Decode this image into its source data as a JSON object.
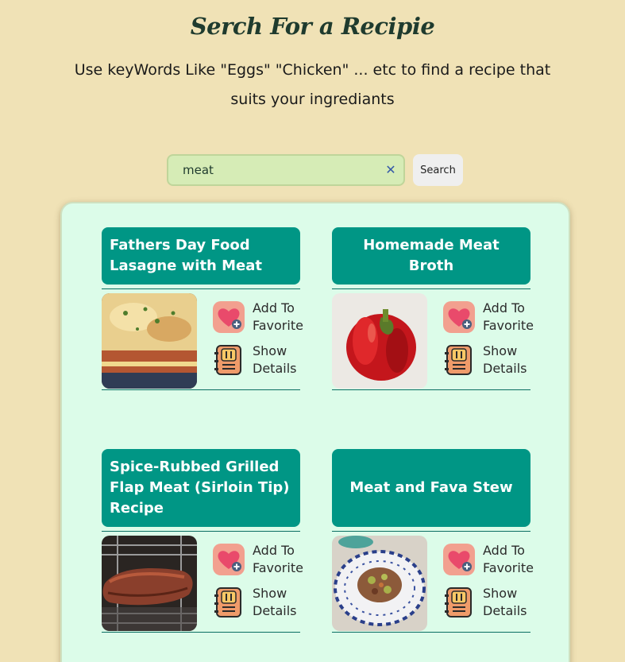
{
  "header": {
    "title": "Serch For a Recipie",
    "subtitle": "Use keyWords Like \"Eggs\" \"Chicken\" ... etc to find a recipe that suits your ingrediants"
  },
  "search": {
    "value": "meat",
    "clear_icon": "close-icon",
    "button_label": "Search"
  },
  "recipes": [
    {
      "title": "Fathers Day Food Lasagne with Meat",
      "image": "lasagna",
      "favorite_label": "Add To Favorite",
      "details_label": "Show Details"
    },
    {
      "title": "Homemade Meat Broth",
      "image": "red-pepper",
      "favorite_label": "Add To Favorite",
      "details_label": "Show Details"
    },
    {
      "title": "Spice-Rubbed Grilled Flap Meat (Sirloin Tip) Recipe",
      "image": "grilled-meat",
      "favorite_label": "Add To Favorite",
      "details_label": "Show Details"
    },
    {
      "title": "Meat and Fava Stew",
      "image": "stew",
      "favorite_label": "Add To Favorite",
      "details_label": "Show Details"
    }
  ],
  "icons": {
    "favorite": "heart-plus-icon",
    "details": "recipe-book-icon"
  },
  "colors": {
    "background": "#f0e2b6",
    "panel": "#dcfce9",
    "accent": "#009685",
    "search_field": "#d6ecb6"
  }
}
